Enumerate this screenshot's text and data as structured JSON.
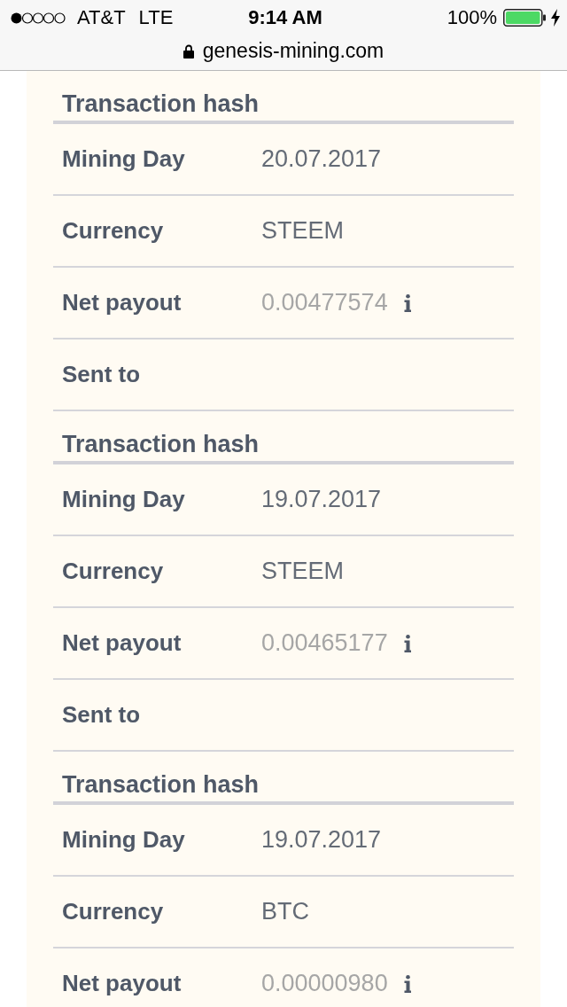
{
  "status_bar": {
    "carrier": "AT&T",
    "network": "LTE",
    "time": "9:14 AM",
    "battery": "100%"
  },
  "address_bar": {
    "url": "genesis-mining.com"
  },
  "payouts": [
    {
      "header": "Transaction hash",
      "rows": [
        {
          "kind": "text",
          "label": "Mining Day",
          "value": "20.07.2017"
        },
        {
          "kind": "text",
          "label": "Currency",
          "value": "STEEM"
        },
        {
          "kind": "amount",
          "label": "Net payout",
          "value": "0.00477574"
        },
        {
          "kind": "text",
          "label": "Sent to"
        }
      ]
    },
    {
      "header": "Transaction hash",
      "rows": [
        {
          "kind": "text",
          "label": "Mining Day",
          "value": "19.07.2017"
        },
        {
          "kind": "text",
          "label": "Currency",
          "value": "STEEM"
        },
        {
          "kind": "amount",
          "label": "Net payout",
          "value": "0.00465177"
        },
        {
          "kind": "text",
          "label": "Sent to"
        }
      ]
    },
    {
      "header": "Transaction hash",
      "rows": [
        {
          "kind": "text",
          "label": "Mining Day",
          "value": "19.07.2017"
        },
        {
          "kind": "text",
          "label": "Currency",
          "value": "BTC"
        },
        {
          "kind": "amount",
          "label": "Net payout",
          "value": "0.00000980"
        }
      ]
    }
  ]
}
